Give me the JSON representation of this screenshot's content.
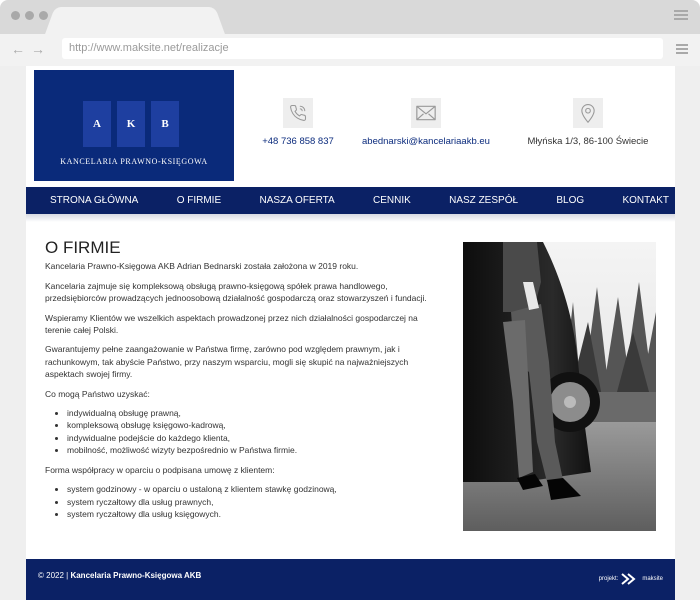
{
  "browser": {
    "url": "http://www.maksite.net/realizacje"
  },
  "logo": {
    "letters": [
      "A",
      "K",
      "B"
    ],
    "subtitle": "KANCELARIA  PRAWNO-KSIĘGOWA"
  },
  "contacts": {
    "phone": "+48 736 858 837",
    "email": "abednarski@kancelariaakb.eu",
    "address": "Młyńska 1/3, 86-100 Świecie"
  },
  "nav": [
    "STRONA GŁÓWNA",
    "O FIRMIE",
    "NASZA OFERTA",
    "CENNIK",
    "NASZ ZESPÓŁ",
    "BLOG",
    "KONTAKT"
  ],
  "content": {
    "title": "O FIRMIE",
    "p1": "Kancelaria Prawno-Księgowa AKB Adrian Bednarski została założona w 2019 roku.",
    "p2": "Kancelaria zajmuje się kompleksową obsługą prawno-księgową spółek prawa handlowego, przedsiębiorców prowadzących jednoosobową działalność gospodarczą oraz stowarzyszeń i fundacji.",
    "p3": "Wspieramy Klientów we wszelkich aspektach prowadzonej przez nich działalności gospodarczej na terenie całej Polski.",
    "p4": "Gwarantujemy pełne zaangażowanie w Państwa firmę, zarówno pod względem prawnym, jak i rachunkowym, tak abyście Państwo, przy naszym wsparciu, mogli się skupić na najważniejszych aspektach swojej firmy.",
    "p5": "Co mogą Państwo uzyskać:",
    "list1": [
      "indywidualną obsługę prawną,",
      "kompleksową obsługę księgowo-kadrową,",
      "indywidualne podejście do każdego klienta,",
      "mobilność, możliwość wizyty bezpośrednio w Państwa firmie."
    ],
    "p6": "Forma współpracy w oparciu o podpisana umowę z klientem:",
    "list2": [
      "system godzinowy - w oparciu o ustaloną z klientem stawkę godzinową,",
      "system ryczałtowy dla usług prawnych,",
      "system ryczałtowy dla usług księgowych."
    ]
  },
  "footer": {
    "copyright": "© 2022 |",
    "company": "Kancelaria Prawno-Księgowa AKB",
    "credit_label": "projekt:",
    "credit_brand": "maksite"
  },
  "colors": {
    "brand_navy": "#0b2165",
    "logo_blue": "#0a2a7a"
  }
}
